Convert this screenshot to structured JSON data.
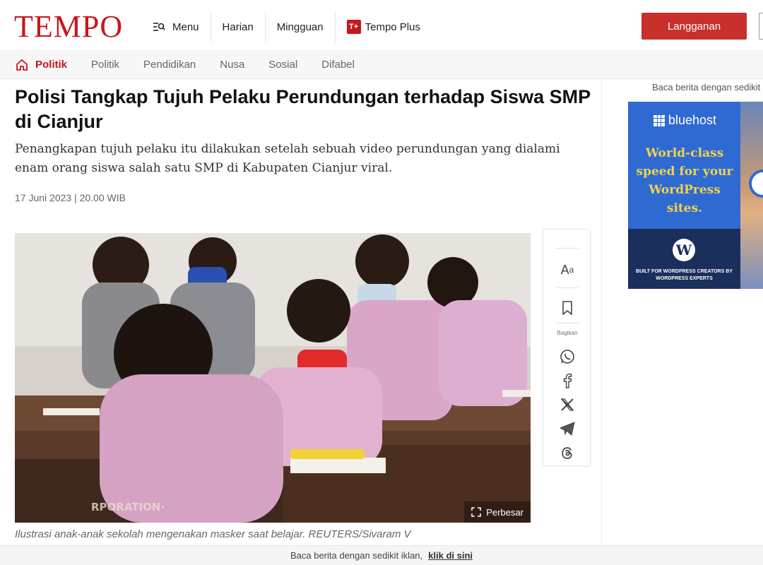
{
  "header": {
    "logo": "TEMPO",
    "nav": [
      {
        "label": "Menu",
        "icon": "menu-search-icon"
      },
      {
        "label": "Harian"
      },
      {
        "label": "Mingguan"
      },
      {
        "label": "Tempo Plus",
        "icon_text": "T+"
      }
    ],
    "subscribe_label": "Langganan"
  },
  "subnav": {
    "tabs": [
      "Politik",
      "Politik",
      "Pendidikan",
      "Nusa",
      "Sosial",
      "Difabel"
    ],
    "active_index": 0
  },
  "article": {
    "title": "Polisi Tangkap Tujuh Pelaku Perundungan terhadap Siswa SMP di Cianjur",
    "lead": "Penangkapan tujuh pelaku itu dilakukan setelah sebuah video perundungan yang dialami enam orang siswa salah satu SMP di Kabupaten Cianjur viral.",
    "date": "17 Juni 2023 | 20.00 WIB",
    "enlarge_label": "Perbesar",
    "caption": "Ilustrasi anak-anak sekolah mengenakan masker saat belajar. REUTERS/Sivaram V"
  },
  "share_rail": {
    "font_icon_big": "A",
    "font_icon_small": "a",
    "share_label": "Bagikan",
    "icons": [
      "font-size-icon",
      "bookmark-icon",
      "whatsapp-icon",
      "facebook-icon",
      "x-icon",
      "telegram-icon",
      "threads-icon"
    ]
  },
  "ad": {
    "note_top": "Baca berita dengan sedikit ik",
    "brand": "bluehost",
    "headline": "World-class speed for your WordPress sites.",
    "wp_letter": "W",
    "small_text": "BUILT FOR WORDPRESS CREATORS BY WORDPRESS EXPERTS",
    "colors": {
      "blue": "#2f6ad3",
      "navy": "#1b2f5c",
      "yellow": "#f3d34a"
    }
  },
  "bottom_bar": {
    "text": "Baca berita dengan sedikit iklan,",
    "link": "klik di sini"
  },
  "colors": {
    "brand_red": "#c8161d",
    "button_red": "#c8302c"
  }
}
